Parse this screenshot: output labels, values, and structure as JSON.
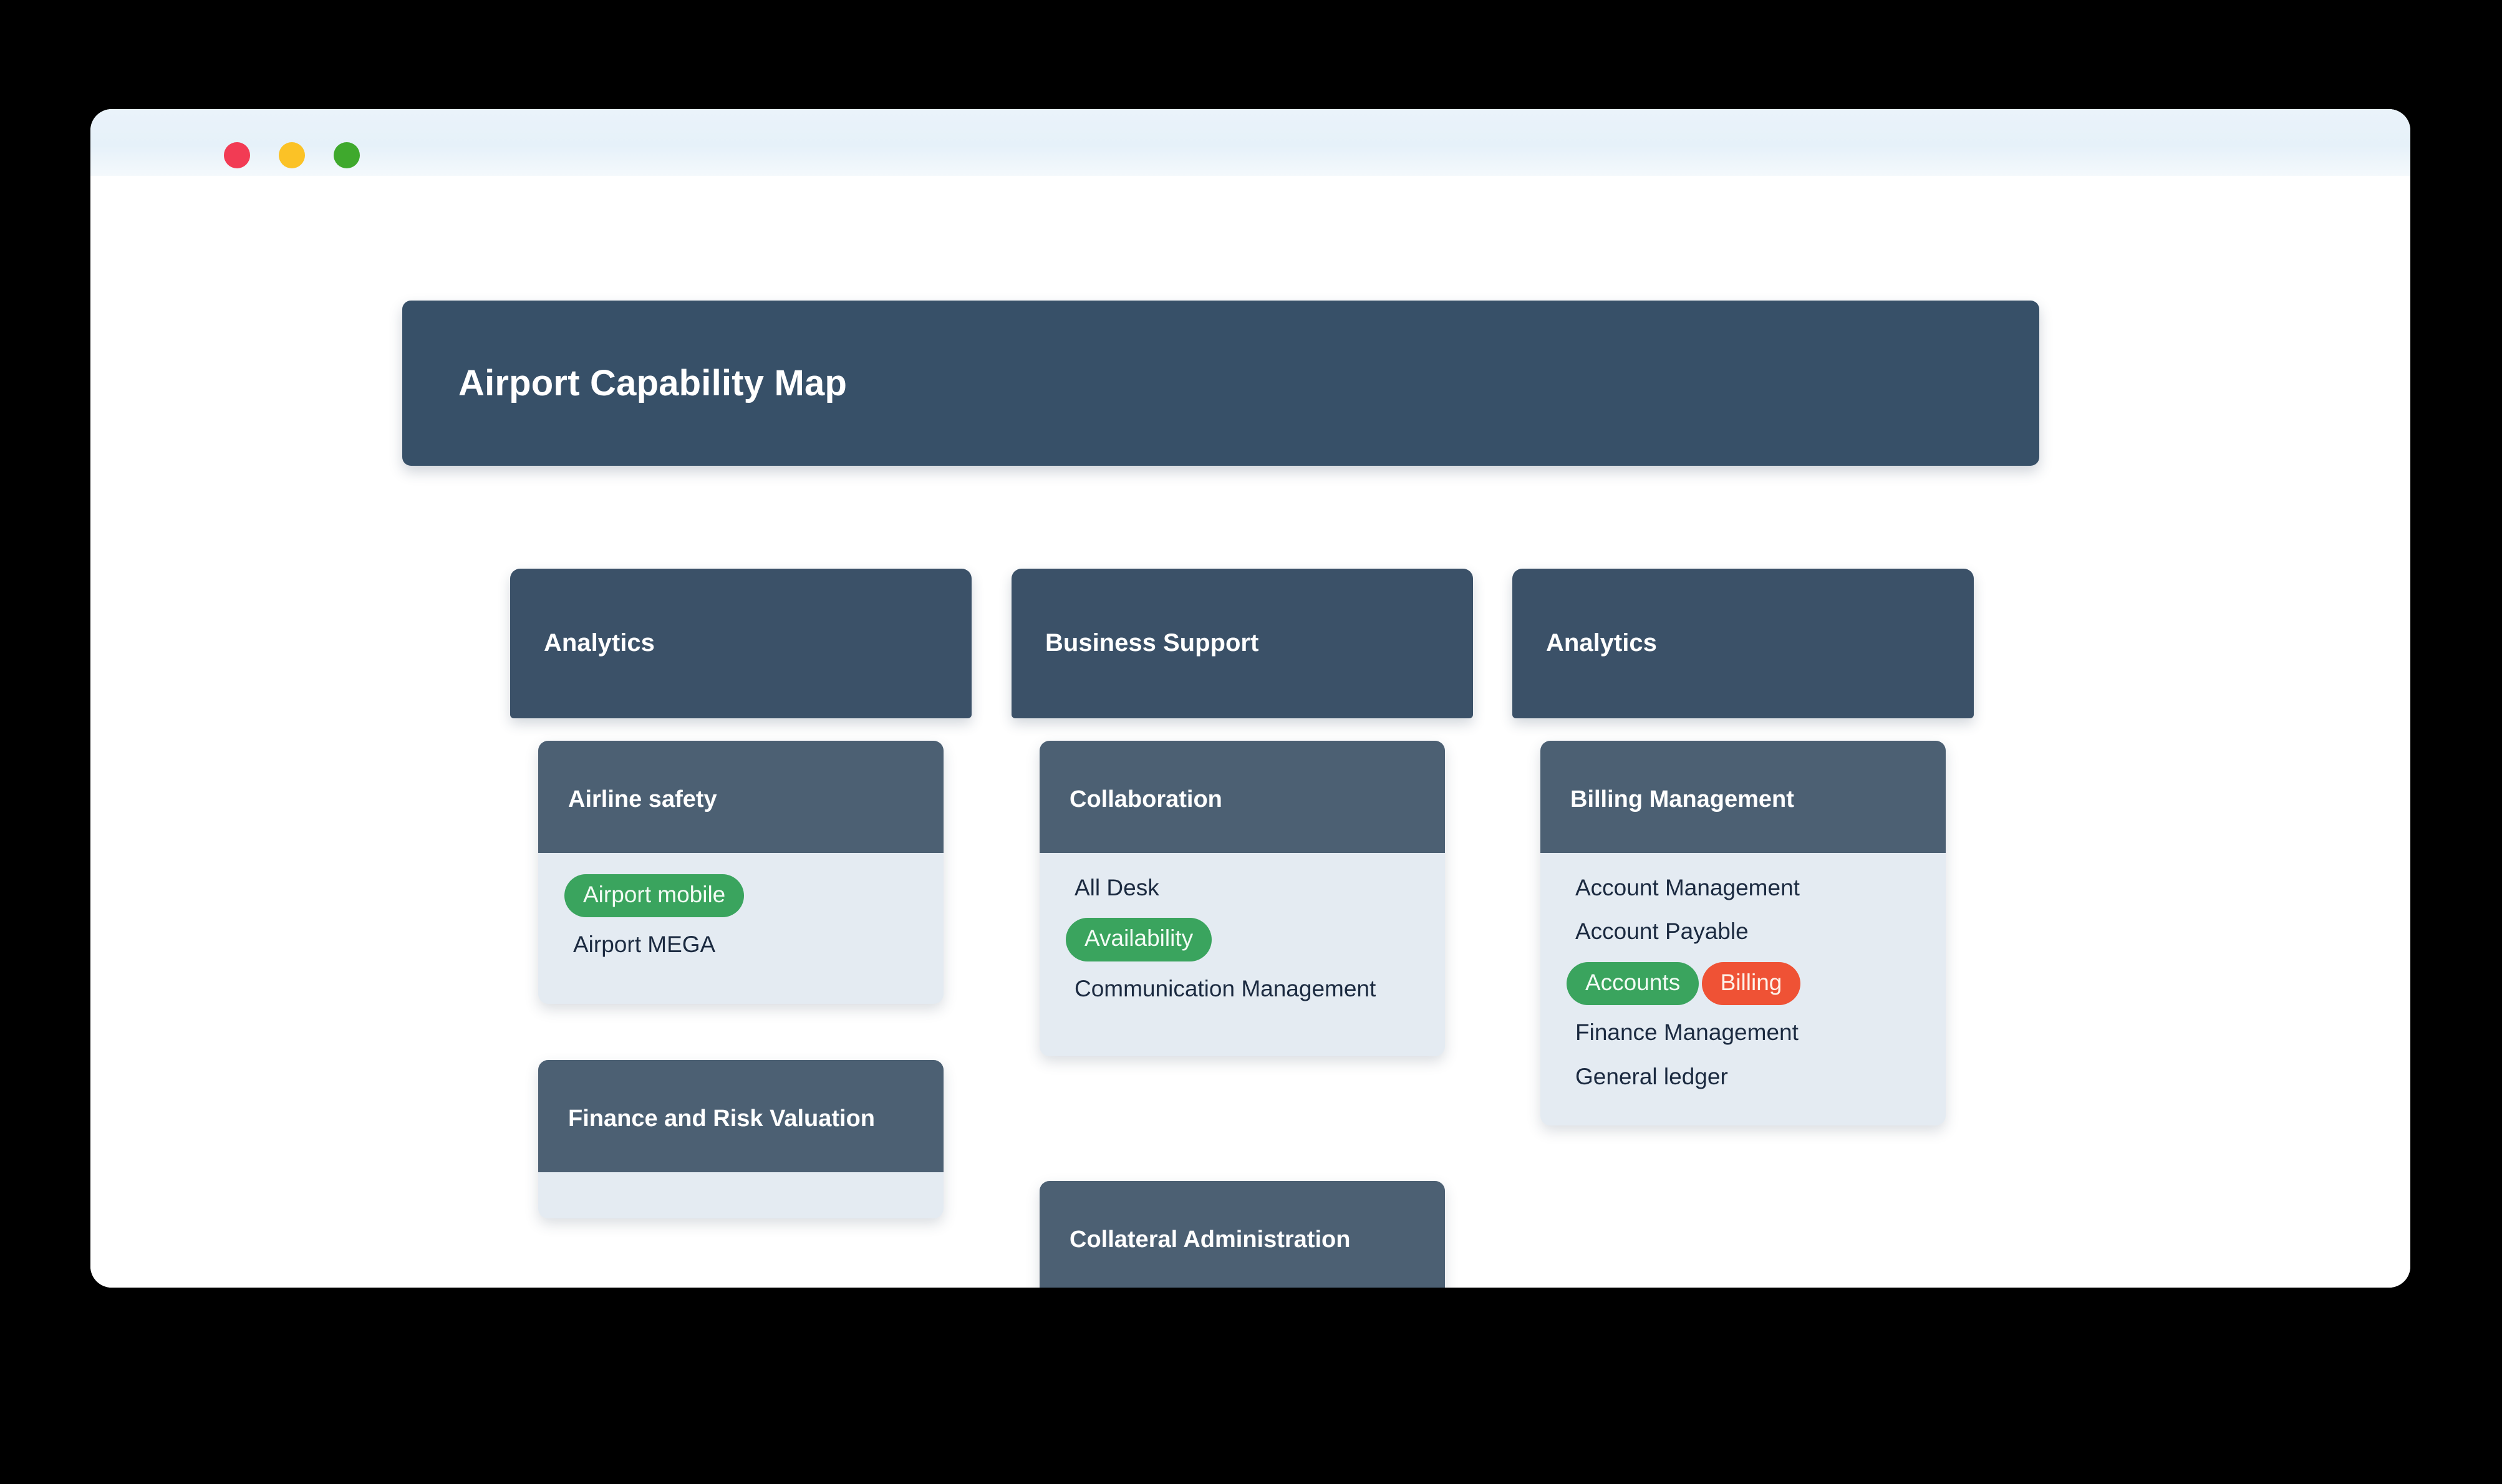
{
  "window": {
    "traffic_lights": [
      {
        "name": "close",
        "color": "#f23b54"
      },
      {
        "name": "minimize",
        "color": "#fbc226"
      },
      {
        "name": "maximize",
        "color": "#3fa92d"
      }
    ]
  },
  "banner": {
    "title": "Airport Capability Map",
    "background": "#375068",
    "text_color": "#ffffff"
  },
  "theme": {
    "group_header_bg": "#3b5168",
    "card_header_bg": "#4c6073",
    "card_body_bg": "#e4ebf2",
    "item_text": "#1b2a40",
    "pill_green": "#3aa45e",
    "pill_red": "#ef5235"
  },
  "columns": [
    {
      "group_label": "Analytics",
      "cards": [
        {
          "title": "Airline safety",
          "items": [
            {
              "label": "Airport mobile",
              "style": "pill-green"
            },
            {
              "label": "Airport MEGA",
              "style": "plain"
            }
          ]
        },
        {
          "title": "Finance and Risk Valuation",
          "items": []
        }
      ]
    },
    {
      "group_label": "Business Support",
      "cards": [
        {
          "title": "Collaboration",
          "items": [
            {
              "label": "All Desk",
              "style": "plain"
            },
            {
              "label": "Availability",
              "style": "pill-green"
            },
            {
              "label": "Communication Management",
              "style": "plain"
            }
          ]
        },
        {
          "title": "Collateral Administration",
          "items": []
        }
      ]
    },
    {
      "group_label": "Analytics",
      "cards": [
        {
          "title": "Billing Management",
          "items": [
            {
              "label": "Account Management",
              "style": "plain"
            },
            {
              "label": "Account Payable",
              "style": "plain"
            },
            {
              "label": "Accounts",
              "style": "pill-green"
            },
            {
              "label": "Billing",
              "style": "pill-red"
            },
            {
              "label": "Finance Management",
              "style": "plain"
            },
            {
              "label": "General ledger",
              "style": "plain"
            }
          ]
        }
      ]
    }
  ]
}
